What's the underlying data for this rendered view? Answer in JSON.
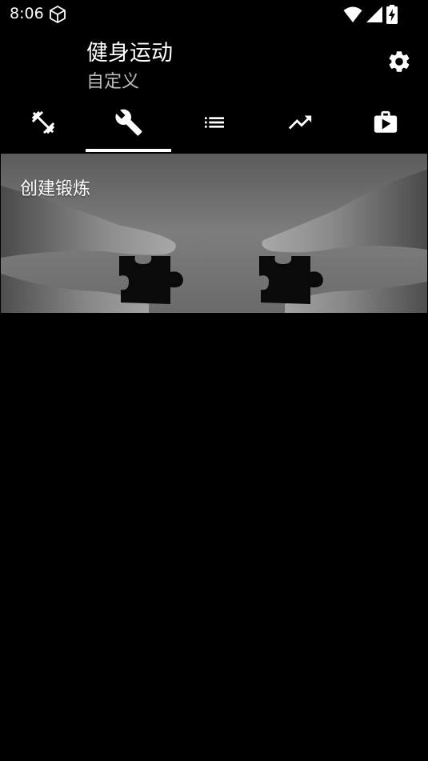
{
  "status_bar": {
    "time": "8:06"
  },
  "app_bar": {
    "title": "健身运动",
    "subtitle": "自定义",
    "settings_icon": "gear-icon"
  },
  "tabs": [
    {
      "icon": "fitness-dumbbell-icon",
      "active": false
    },
    {
      "icon": "wrench-icon",
      "active": true
    },
    {
      "icon": "list-icon",
      "active": false
    },
    {
      "icon": "trending-up-icon",
      "active": false
    },
    {
      "icon": "play-bag-icon",
      "active": false
    }
  ],
  "banner": {
    "label": "创建锻炼"
  },
  "colors": {
    "background": "#000000",
    "text_primary": "#ffffff",
    "text_secondary": "#bdbdbd",
    "tab_indicator": "#ffffff"
  }
}
